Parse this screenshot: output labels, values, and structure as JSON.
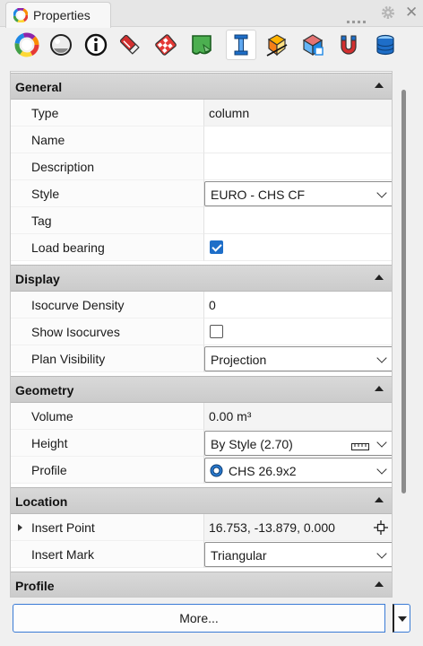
{
  "window": {
    "tab_title": "Properties",
    "tab_icon": "color-wheel-icon"
  },
  "toolbar": {
    "buttons": [
      {
        "icon": "color-wheel-icon",
        "active": false
      },
      {
        "icon": "material-sphere-icon",
        "active": false
      },
      {
        "icon": "info-icon",
        "active": false
      },
      {
        "icon": "pencil-attribute-icon",
        "active": false
      },
      {
        "icon": "texture-mapping-icon",
        "active": false
      },
      {
        "icon": "green-surface-icon",
        "active": false
      },
      {
        "icon": "column-i-beam-icon",
        "active": true
      },
      {
        "icon": "clipping-drafting-icon",
        "active": false
      },
      {
        "icon": "cube-link-icon",
        "active": false
      },
      {
        "icon": "magnet-snap-icon",
        "active": false
      },
      {
        "icon": "database-stack-icon",
        "active": false
      }
    ]
  },
  "sections": {
    "general": {
      "title": "General",
      "type_label": "Type",
      "type_value": "column",
      "name_label": "Name",
      "name_value": "",
      "description_label": "Description",
      "description_value": "",
      "style_label": "Style",
      "style_value": "EURO - CHS CF",
      "tag_label": "Tag",
      "tag_value": "",
      "load_bearing_label": "Load bearing",
      "load_bearing_checked": true
    },
    "display": {
      "title": "Display",
      "isocurve_density_label": "Isocurve Density",
      "isocurve_density_value": "0",
      "show_isocurves_label": "Show Isocurves",
      "show_isocurves_checked": false,
      "plan_visibility_label": "Plan Visibility",
      "plan_visibility_value": "Projection"
    },
    "geometry": {
      "title": "Geometry",
      "volume_label": "Volume",
      "volume_value": "0.00 m³",
      "height_label": "Height",
      "height_value": "By Style (2.70)",
      "profile_label": "Profile",
      "profile_value": "CHS 26.9x2"
    },
    "location": {
      "title": "Location",
      "insert_point_label": "Insert Point",
      "insert_point_value": "16.753, -13.879, 0.000",
      "insert_mark_label": "Insert Mark",
      "insert_mark_value": "Triangular"
    },
    "profile": {
      "title": "Profile"
    }
  },
  "footer": {
    "more_label": "More..."
  },
  "colors": {
    "accent": "#1e6ec8",
    "section_header": "#d2d2d2",
    "button_border": "#3a7bd5"
  }
}
